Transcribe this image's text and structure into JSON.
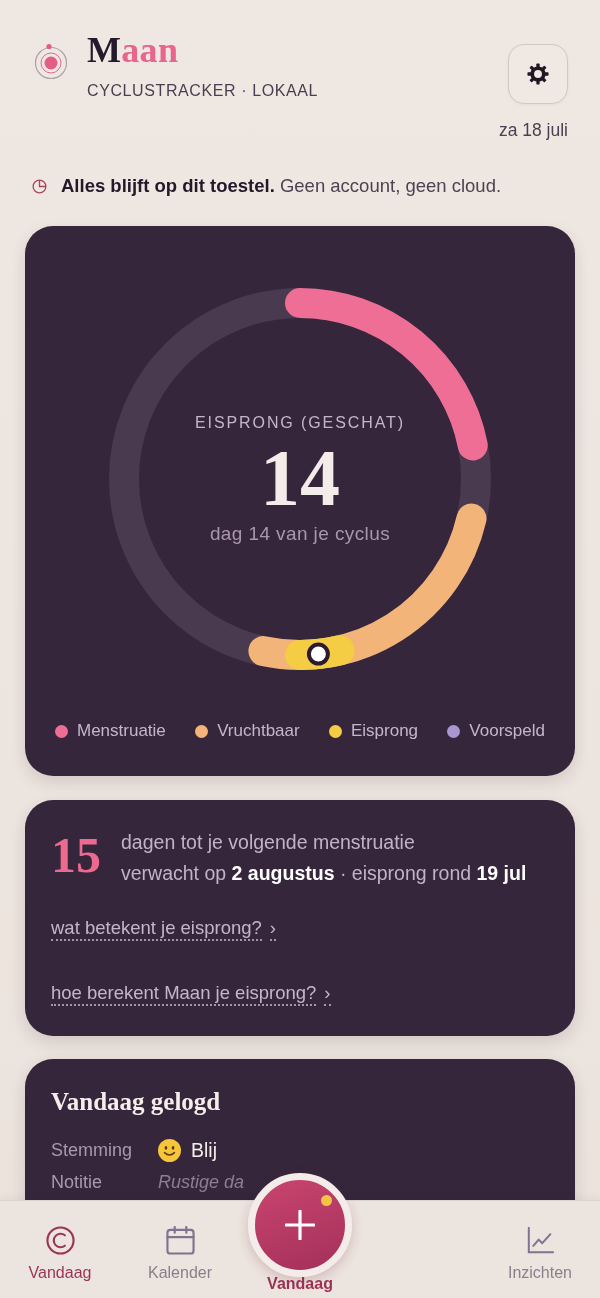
{
  "header": {
    "title": "Maan",
    "subtitle": "CYCLUSTRACKER · LOKAAL",
    "date": "za 18 juli"
  },
  "privacy": {
    "text": "**Alles blijft op dit toestel.** Geen account, geen cloud."
  },
  "cycle_card": {
    "phase": "EISPRONG (GESCHAT)",
    "day": "14",
    "caption": "dag 14 van je cyclus",
    "legend": [
      {
        "label": "Menstruatie",
        "color": "#ef6e95"
      },
      {
        "label": "Vruchtbaar",
        "color": "#f2b478"
      },
      {
        "label": "Eisprong",
        "color": "#f5cd45"
      },
      {
        "label": "Voorspeld",
        "color": "#a995cf"
      }
    ]
  },
  "next_card": {
    "count": "15",
    "line": "dagen tot je volgende menstruatie",
    "detail": "verwacht op **2 augustus** · eisprong rond **19 jul**",
    "links": [
      {
        "label": "wat betekent je eisprong?",
        "chevron": "›"
      },
      {
        "label": "hoe berekent Maan je eisprong?",
        "chevron": "›"
      }
    ]
  },
  "log_card": {
    "title": "Vandaag gelogd",
    "rows": [
      {
        "label": "Stemming",
        "value": "Blij",
        "kind": "mood"
      },
      {
        "label": "Notitie",
        "value": "Rustige da",
        "kind": "note"
      }
    ]
  },
  "nav": {
    "items": [
      {
        "label": "Vandaag",
        "kind": "today",
        "selected": true
      },
      {
        "label": "Kalender",
        "kind": "calendar",
        "selected": false
      },
      {
        "label": "Inzichten",
        "kind": "insights",
        "selected": false
      }
    ],
    "add_button": {
      "label": "Vandaag",
      "badge": true
    }
  }
}
